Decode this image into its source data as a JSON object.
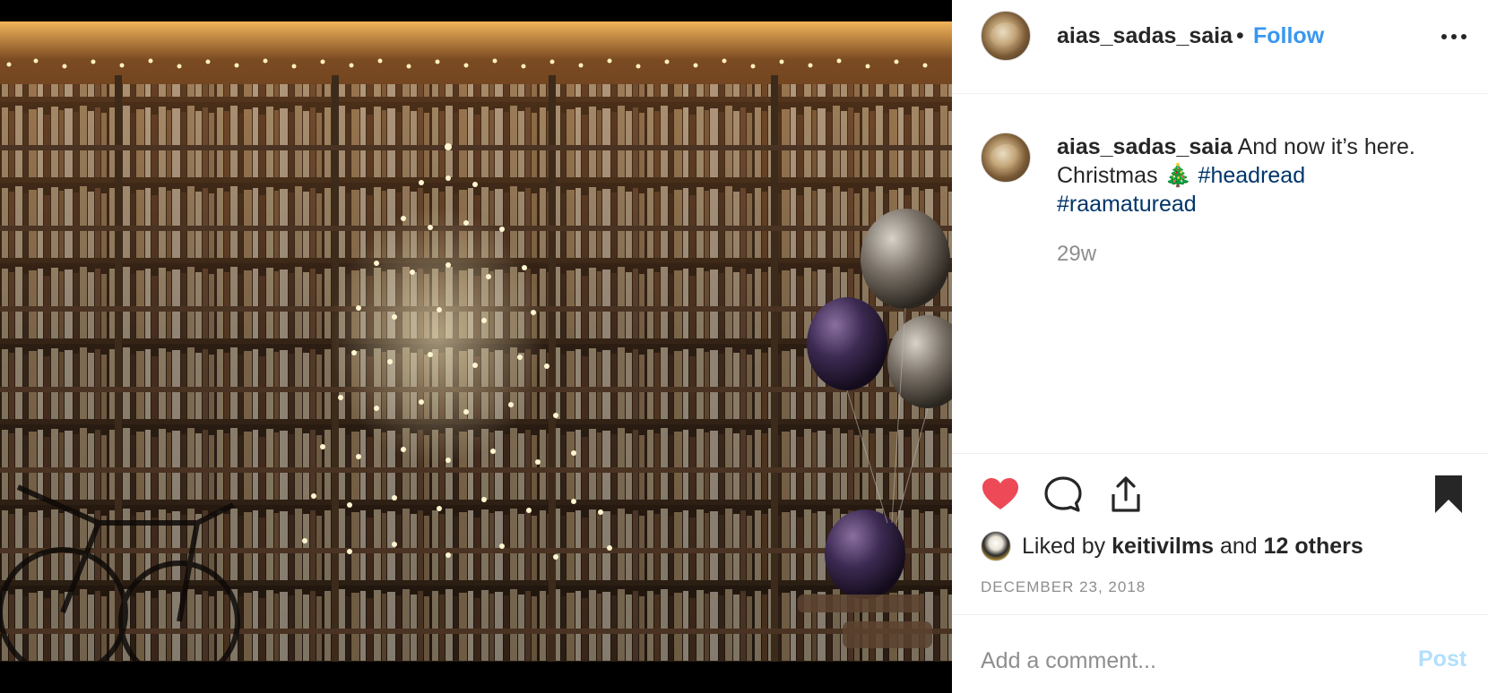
{
  "post": {
    "username": "aias_sadas_saia",
    "separator": "•",
    "follow_label": "Follow",
    "caption": {
      "username": "aias_sadas_saia",
      "text_line1": " And now it’s here.",
      "text_line2": "Christmas 🎄 ",
      "hashtags": [
        "#headread",
        "#raamaturead"
      ]
    },
    "time_ago": "29w",
    "likes": {
      "prefix": "Liked by ",
      "first_liker": "keitivilms",
      "connector": " and ",
      "others": "12 others"
    },
    "date": "DECEMBER 23, 2018",
    "comment_placeholder": "Add a comment...",
    "post_label": "Post"
  },
  "icons": {
    "like": "heart-icon",
    "comment": "comment-icon",
    "share": "share-icon",
    "save": "bookmark-icon",
    "more": "more-options-icon"
  },
  "colors": {
    "like": "#ed4956",
    "follow": "#3897f0",
    "hashtag": "#003569",
    "muted": "#8e8e8e",
    "post_disabled": "#b2dffc"
  }
}
